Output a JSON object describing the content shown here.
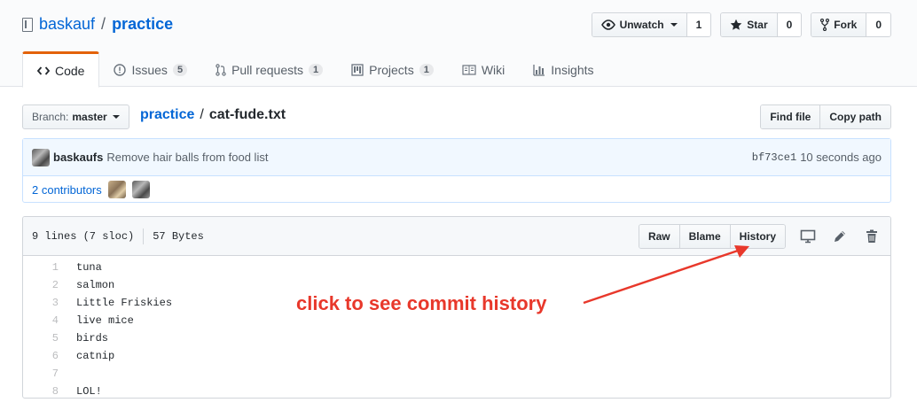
{
  "header": {
    "owner": "baskauf",
    "repo": "practice",
    "actions": [
      {
        "label": "Unwatch",
        "count": "1",
        "icon": "eye-icon"
      },
      {
        "label": "Star",
        "count": "0",
        "icon": "star-icon"
      },
      {
        "label": "Fork",
        "count": "0",
        "icon": "fork-icon"
      }
    ]
  },
  "tabs": [
    {
      "label": "Code",
      "badge": "",
      "icon": "code-icon"
    },
    {
      "label": "Issues",
      "badge": "5",
      "icon": "issue-icon"
    },
    {
      "label": "Pull requests",
      "badge": "1",
      "icon": "pull-request-icon"
    },
    {
      "label": "Projects",
      "badge": "1",
      "icon": "project-icon"
    },
    {
      "label": "Wiki",
      "badge": "",
      "icon": "book-icon"
    },
    {
      "label": "Insights",
      "badge": "",
      "icon": "graph-icon"
    }
  ],
  "file_nav": {
    "branch_prefix": "Branch:",
    "branch": "master",
    "breadcrumb_repo": "practice",
    "breadcrumb_sep": "/",
    "file_name": "cat-fude.txt",
    "find_file": "Find file",
    "copy_path": "Copy path"
  },
  "commit": {
    "author": "baskaufs",
    "message": "Remove hair balls from food list",
    "sha": "bf73ce1",
    "time": "10 seconds ago",
    "contributors": "2 contributors"
  },
  "file": {
    "lines_info": "9 lines (7 sloc)",
    "size": "57 Bytes",
    "raw": "Raw",
    "blame": "Blame",
    "history": "History",
    "lines": [
      {
        "n": "1",
        "t": "tuna"
      },
      {
        "n": "2",
        "t": "salmon"
      },
      {
        "n": "3",
        "t": "Little Friskies"
      },
      {
        "n": "4",
        "t": "live mice"
      },
      {
        "n": "5",
        "t": "birds"
      },
      {
        "n": "6",
        "t": "catnip"
      },
      {
        "n": "7",
        "t": ""
      },
      {
        "n": "8",
        "t": "LOL!"
      }
    ]
  },
  "annotation": {
    "text": "click to see commit history",
    "color": "#e8382b"
  }
}
